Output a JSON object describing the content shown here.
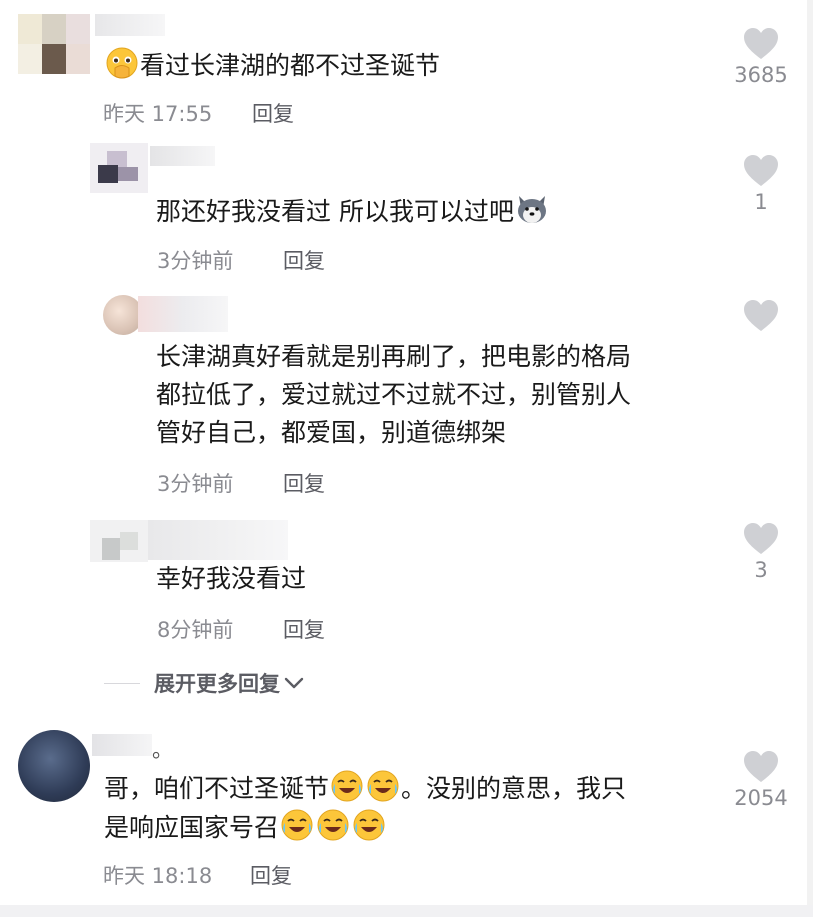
{
  "comments": [
    {
      "text": "看过长津湖的都不过圣诞节",
      "time": "昨天 17:55",
      "reply_label": "回复",
      "likes": "3685",
      "emoji_prefix": "pleading-hands-emoji"
    },
    {
      "text": "那还好我没看过 所以我可以过吧",
      "time": "3分钟前",
      "reply_label": "回复",
      "likes": "1",
      "emoji_suffix": "husky-dog-emoji"
    },
    {
      "text_lines": [
        "长津湖真好看就是别再刷了，把电影的格局",
        "都拉低了，爱过就过不过就不过，别管别人",
        "管好自己，都爱国，别道德绑架"
      ],
      "time": "3分钟前",
      "reply_label": "回复",
      "likes": ""
    },
    {
      "text": "幸好我没看过",
      "time": "8分钟前",
      "reply_label": "回复",
      "likes": "3"
    },
    {
      "name_suffix": "。",
      "text_lines": [
        "哥，咱们不过圣诞节",
        "。没别的意思，我只",
        "是响应国家号召"
      ],
      "time": "昨天 18:18",
      "reply_label": "回复",
      "likes": "2054",
      "emoji": "crying-laughing-emoji"
    }
  ],
  "expand_replies_label": "展开更多回复",
  "icons": {
    "like": "heart-icon",
    "expand": "chevron-down-icon"
  },
  "colors": {
    "text": "#1a1a1a",
    "meta": "#8a8b91",
    "heart": "#cfd0d4"
  }
}
